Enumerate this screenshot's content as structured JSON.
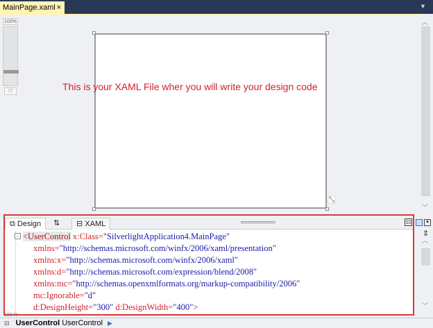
{
  "document_tab": {
    "title": "MainPage.xaml",
    "close": "×"
  },
  "zoom": {
    "level": "100%"
  },
  "artboard": {
    "annotation": "This is your XAML File wher you will write your design code"
  },
  "panel_tabs": {
    "design": "Design",
    "swap": "⇅",
    "xaml": "XAML"
  },
  "code_lines": [
    {
      "tag": "<UserControl",
      "attr": " x:Class=",
      "val": "\"SilverlightApplication4.MainPage\""
    },
    {
      "attr": "xmlns=",
      "val": "\"http://schemas.microsoft.com/winfx/2006/xaml/presentation\""
    },
    {
      "attr": "xmlns:x=",
      "val": "\"http://schemas.microsoft.com/winfx/2006/xaml\""
    },
    {
      "attr": "xmlns:d=",
      "val": "\"http://schemas.microsoft.com/expression/blend/2008\""
    },
    {
      "attr": "xmlns:mc=",
      "val": "\"http://schemas.openxmlformats.org/markup-compatibility/2006\""
    },
    {
      "attr": "mc:Ignorable=",
      "val": "\"d\""
    },
    {
      "attr": "d:DesignHeight=",
      "val": "\"300\"",
      "attr2": " d:DesignWidth=",
      "val2": "\"400\"",
      "end": ">"
    }
  ],
  "code_zoom": "100 %",
  "status": {
    "element": "UserControl",
    "type": "UserControl"
  }
}
